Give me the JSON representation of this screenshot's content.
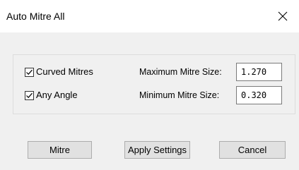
{
  "window": {
    "title": "Auto Mitre All"
  },
  "options": {
    "curved_mitres": {
      "label": "Curved Mitres",
      "checked": true
    },
    "any_angle": {
      "label": "Any Angle",
      "checked": true
    }
  },
  "fields": {
    "max_size": {
      "label": "Maximum Mitre Size:",
      "value": "1.270"
    },
    "min_size": {
      "label": "Minimum Mitre Size:",
      "value": "0.320"
    }
  },
  "buttons": {
    "mitre": "Mitre",
    "apply_settings": "Apply Settings",
    "cancel": "Cancel"
  }
}
